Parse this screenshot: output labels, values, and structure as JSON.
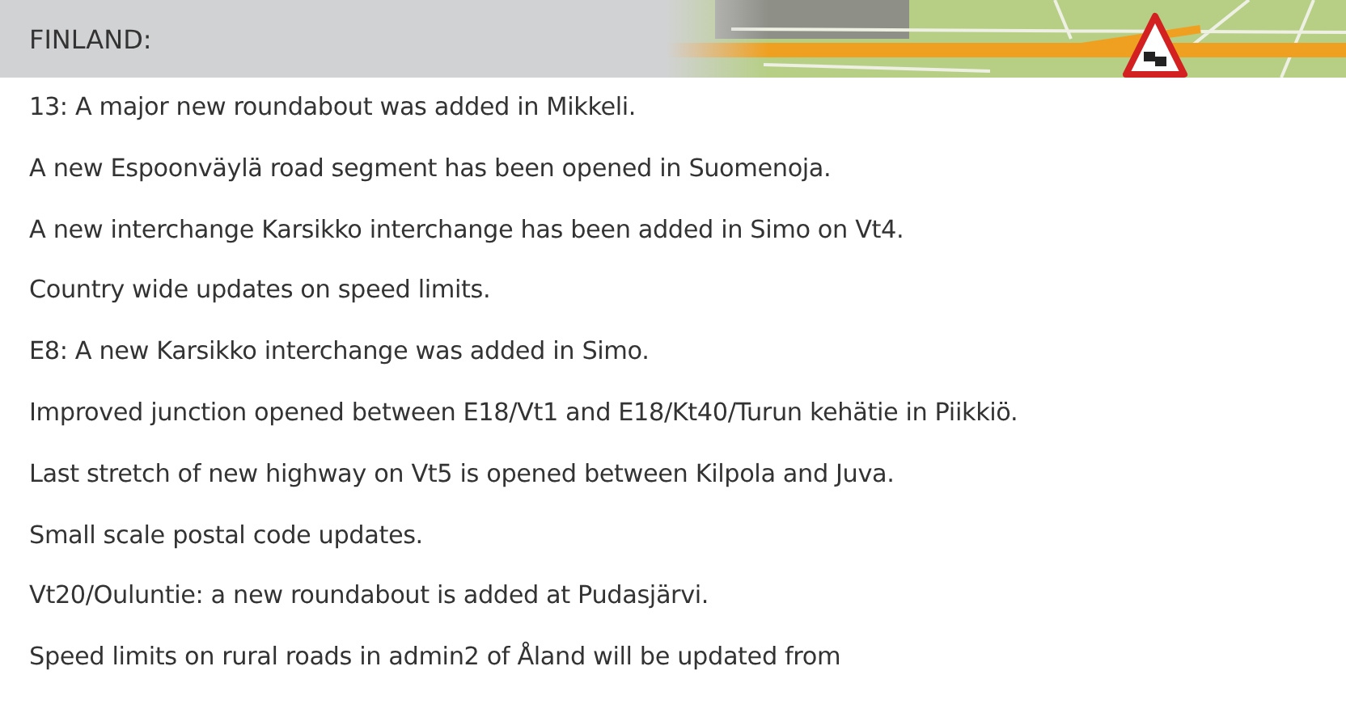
{
  "header": {
    "title": "FINLAND:"
  },
  "items": [
    "13: A major new roundabout was added in Mikkeli.",
    "A new Espoonväylä road segment has been opened in Suomenoja.",
    "A new interchange Karsikko interchange has been added in Simo on Vt4.",
    "Country wide updates on speed limits.",
    "E8: A new Karsikko interchange was added in Simo.",
    "Improved junction opened between E18/Vt1 and E18/Kt40/Turun kehätie in Piikkiö.",
    "Last stretch of new highway on Vt5 is opened between Kilpola and Juva.",
    "Small scale postal code updates.",
    "Vt20/Ouluntie: a new roundabout is added at Pudasjärvi.",
    "Speed limits on rural roads in admin2 of Åland will be updated from"
  ]
}
